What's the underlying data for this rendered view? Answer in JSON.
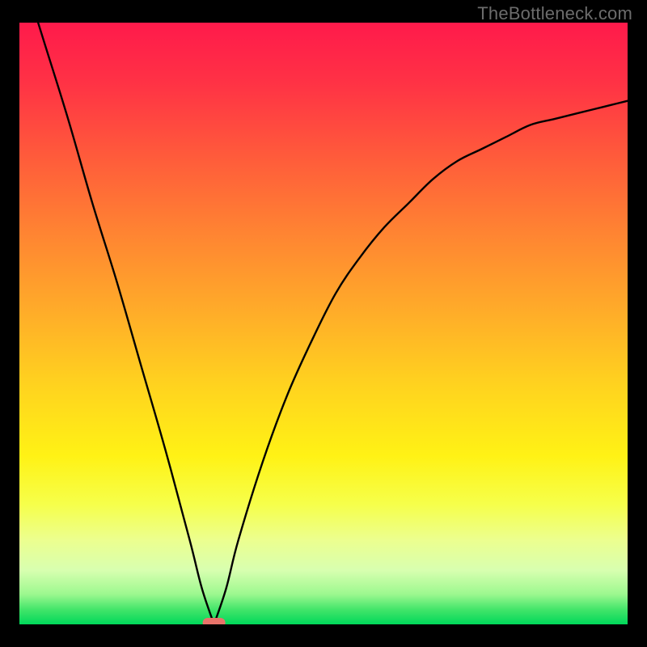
{
  "watermark": "TheBottleneck.com",
  "chart_data": {
    "type": "line",
    "title": "",
    "xlabel": "",
    "ylabel": "",
    "xlim": [
      0,
      100
    ],
    "ylim": [
      0,
      100
    ],
    "grid": false,
    "legend": false,
    "description": "Bottleneck percentage curve over a rainbow vertical gradient (red high → green low). Curve drops from top-left to a cusp near x≈32, y≈0, then rises and levels off toward the right.",
    "series": [
      {
        "name": "bottleneck-curve",
        "x": [
          0,
          4,
          8,
          12,
          16,
          20,
          24,
          28,
          30,
          32,
          34,
          36,
          40,
          44,
          48,
          52,
          56,
          60,
          64,
          68,
          72,
          76,
          80,
          84,
          88,
          92,
          96,
          100
        ],
        "y": [
          110,
          97,
          84,
          70,
          57,
          43,
          29,
          14,
          6,
          0,
          6,
          14,
          27,
          38,
          47,
          55,
          61,
          66,
          70,
          74,
          77,
          79,
          81,
          83,
          84,
          85,
          86,
          87
        ]
      }
    ],
    "marker": {
      "x": 32,
      "y": 0,
      "color": "#e8736a"
    },
    "gradient_stops": [
      {
        "offset": 0.0,
        "color": "#ff1a4b"
      },
      {
        "offset": 0.1,
        "color": "#ff3245"
      },
      {
        "offset": 0.22,
        "color": "#ff5a3b"
      },
      {
        "offset": 0.35,
        "color": "#ff8432"
      },
      {
        "offset": 0.48,
        "color": "#ffac29"
      },
      {
        "offset": 0.6,
        "color": "#ffd21f"
      },
      {
        "offset": 0.72,
        "color": "#fff215"
      },
      {
        "offset": 0.8,
        "color": "#f6ff4a"
      },
      {
        "offset": 0.86,
        "color": "#ecff8f"
      },
      {
        "offset": 0.91,
        "color": "#d8ffb0"
      },
      {
        "offset": 0.95,
        "color": "#9cf88f"
      },
      {
        "offset": 0.975,
        "color": "#44e56a"
      },
      {
        "offset": 1.0,
        "color": "#00d85a"
      }
    ]
  }
}
